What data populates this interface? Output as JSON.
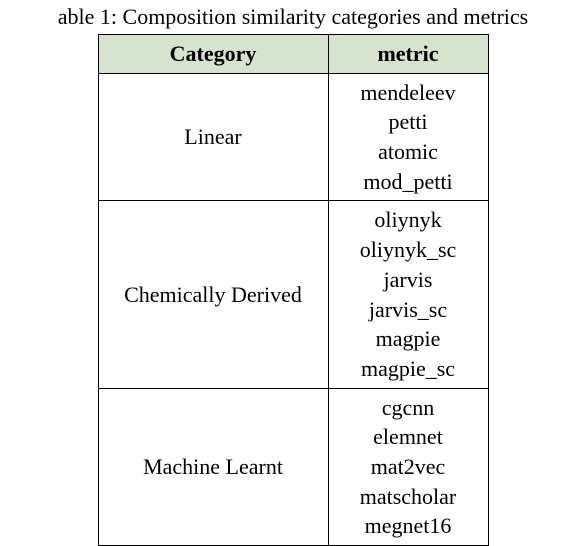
{
  "caption": "able 1: Composition similarity categories and metrics",
  "headers": {
    "category": "Category",
    "metric": "metric"
  },
  "rows": [
    {
      "category": "Linear",
      "metrics": [
        "mendeleev",
        "petti",
        "atomic",
        "mod_petti"
      ]
    },
    {
      "category": "Chemically Derived",
      "metrics": [
        "oliynyk",
        "oliynyk_sc",
        "jarvis",
        "jarvis_sc",
        "magpie",
        "magpie_sc"
      ]
    },
    {
      "category": "Machine Learnt",
      "metrics": [
        "cgcnn",
        "elemnet",
        "mat2vec",
        "matscholar",
        "megnet16"
      ]
    }
  ]
}
